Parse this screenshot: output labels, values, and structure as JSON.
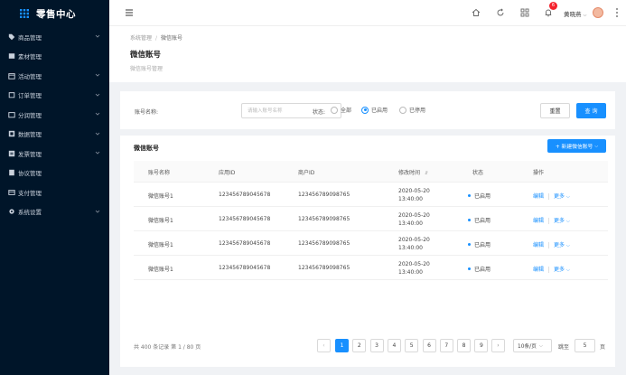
{
  "app": {
    "title": "零售中心"
  },
  "sidebar": {
    "items": [
      {
        "label": "商品管理",
        "icon": "tag-icon",
        "has_children": true
      },
      {
        "label": "素材管理",
        "icon": "image-icon",
        "has_children": false
      },
      {
        "label": "活动管理",
        "icon": "calendar-icon",
        "has_children": true
      },
      {
        "label": "订单管理",
        "icon": "order-icon",
        "has_children": true
      },
      {
        "label": "分润管理",
        "icon": "share-icon",
        "has_children": true
      },
      {
        "label": "数据管理",
        "icon": "chart-icon",
        "has_children": true
      },
      {
        "label": "发票管理",
        "icon": "invoice-icon",
        "has_children": true
      },
      {
        "label": "协议管理",
        "icon": "document-icon",
        "has_children": false
      },
      {
        "label": "支付管理",
        "icon": "card-icon",
        "has_children": false
      },
      {
        "label": "系统设置",
        "icon": "gear-icon",
        "has_children": true
      }
    ]
  },
  "topbar": {
    "notification_count": "6",
    "username": "黄晓燕"
  },
  "page": {
    "breadcrumb": [
      "系统管理",
      "微信账号"
    ],
    "title": "微信账号",
    "description": "微信账号管理"
  },
  "filter": {
    "account_label": "账号名称:",
    "account_placeholder": "请输入账号名称",
    "account_value": "",
    "status_label": "状态:",
    "status_options": [
      "全部",
      "已启用",
      "已停用"
    ],
    "status_selected": 1,
    "reset_label": "重置",
    "search_label": "查 询"
  },
  "table": {
    "title": "微信账号",
    "new_button": "+ 新建微信账号",
    "columns": [
      "账号名称",
      "应用ID",
      "商户ID",
      "修改时间",
      "状态",
      "操作"
    ],
    "rows": [
      {
        "name": "微信账号1",
        "app_id": "123456789045678",
        "merchant_id": "123456789098765",
        "date": "2020-05-20",
        "time": "13:40:00",
        "status": "已启用",
        "edit": "编辑",
        "more": "更多"
      },
      {
        "name": "微信账号1",
        "app_id": "123456789045678",
        "merchant_id": "123456789098765",
        "date": "2020-05-20",
        "time": "13:40:00",
        "status": "已启用",
        "edit": "编辑",
        "more": "更多"
      },
      {
        "name": "微信账号1",
        "app_id": "123456789045678",
        "merchant_id": "123456789098765",
        "date": "2020-05-20",
        "time": "13:40:00",
        "status": "已启用",
        "edit": "编辑",
        "more": "更多"
      },
      {
        "name": "微信账号1",
        "app_id": "123456789045678",
        "merchant_id": "123456789098765",
        "date": "2020-05-20",
        "time": "13:40:00",
        "status": "已启用",
        "edit": "编辑",
        "more": "更多"
      }
    ]
  },
  "pagination": {
    "total_text": "共 400 条记录 第 1 / 80 页",
    "pages": [
      "1",
      "2",
      "3",
      "4",
      "5",
      "6",
      "7",
      "8",
      "9"
    ],
    "current": 1,
    "page_size": "10条/页",
    "goto_label": "跳至",
    "goto_value": "5",
    "page_unit": "页"
  },
  "colors": {
    "sidebar_bg": "#001529",
    "primary": "#1890ff",
    "badge": "#f5222d"
  }
}
